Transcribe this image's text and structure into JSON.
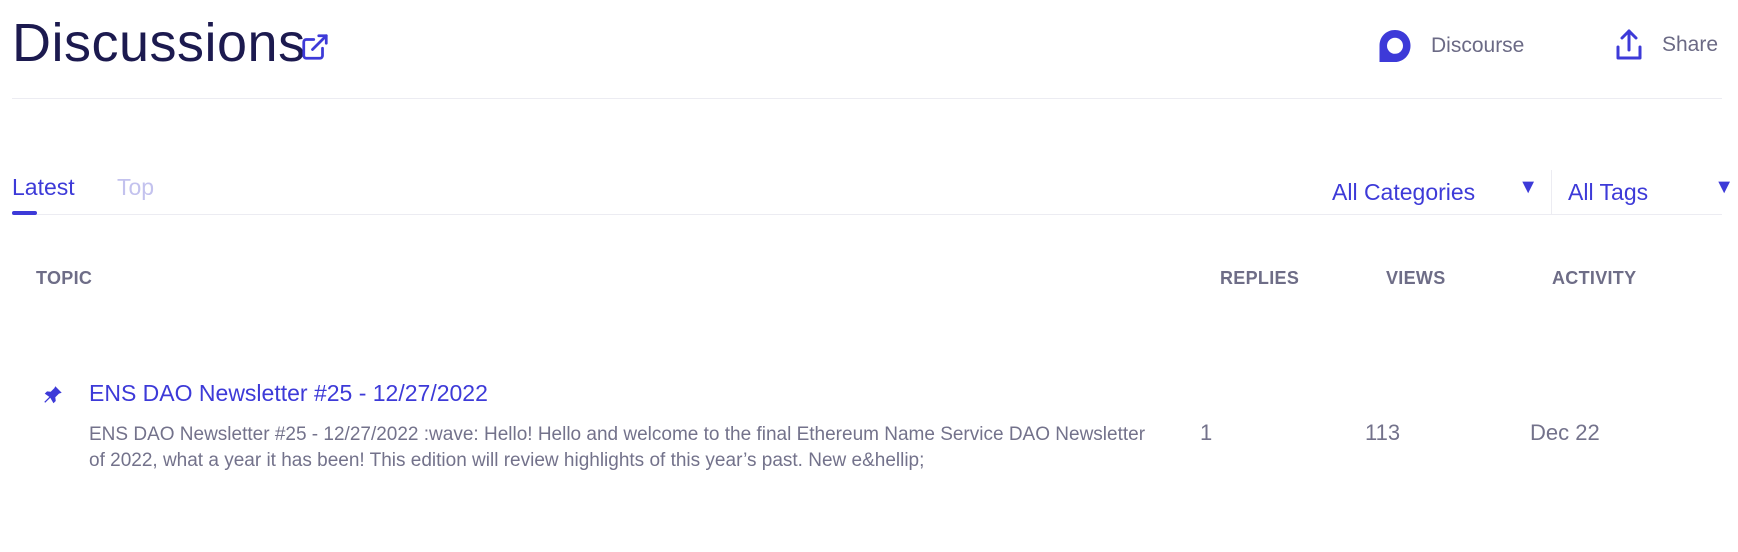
{
  "header": {
    "title": "Discussions",
    "discourse_label": "Discourse",
    "share_label": "Share"
  },
  "tabs": [
    {
      "label": "Latest",
      "active": true
    },
    {
      "label": "Top",
      "active": false
    }
  ],
  "filters": {
    "categories": "All Categories",
    "tags": "All Tags"
  },
  "columns": {
    "topic": "TOPIC",
    "replies": "REPLIES",
    "views": "VIEWS",
    "activity": "ACTIVITY"
  },
  "topics": [
    {
      "pinned": true,
      "title": "ENS DAO Newsletter #25 - 12/27/2022",
      "excerpt": "ENS DAO Newsletter #25 - 12/27/2022 :wave: Hello! Hello and welcome to the final Ethereum Name Service DAO Newsletter of 2022, what a year it has been! This edition will review highlights of this year’s past. New e&hellip;",
      "replies": "1",
      "views": "113",
      "activity": "Dec 22"
    }
  ],
  "colors": {
    "accent": "#3d3ad8",
    "muted": "#73728b"
  },
  "icons": {
    "external": "external-link-icon",
    "discourse": "discourse-icon",
    "share": "share-icon",
    "pin": "pin-icon",
    "dropdown": "caret-down-icon"
  }
}
